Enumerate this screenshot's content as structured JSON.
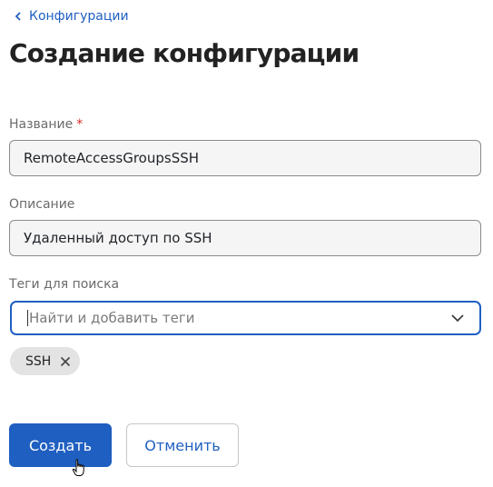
{
  "breadcrumb": {
    "label": "Конфигурации"
  },
  "page": {
    "title": "Создание конфигурации"
  },
  "form": {
    "name": {
      "label": "Название",
      "required_mark": "*",
      "value": "RemoteAccessGroupsSSH"
    },
    "description": {
      "label": "Описание",
      "value": "Удаленный доступ по SSH"
    },
    "tags": {
      "label": "Теги для поиска",
      "placeholder": "Найти и добавить теги",
      "items": [
        {
          "label": "SSH"
        }
      ]
    }
  },
  "actions": {
    "create_label": "Создать",
    "cancel_label": "Отменить"
  },
  "colors": {
    "accent": "#1f5fc1",
    "required": "#d62828",
    "chip_bg": "#e3e3e3"
  },
  "icons": [
    "chevron-left-icon",
    "chevron-down-icon",
    "close-icon",
    "hand-cursor-icon"
  ]
}
